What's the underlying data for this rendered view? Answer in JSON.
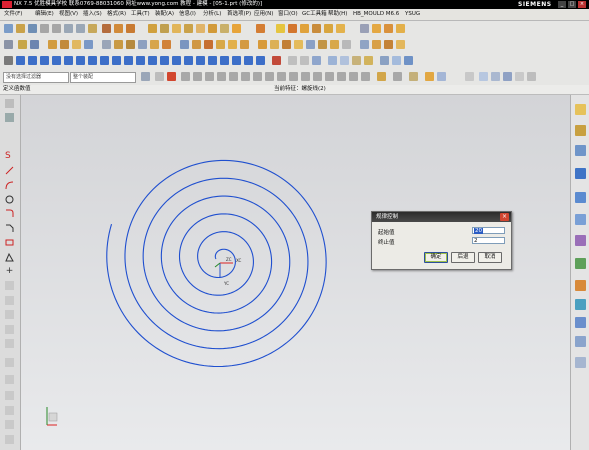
{
  "window": {
    "title": "NX 7.5 优胜模具学校 联系0769-88031060 网址www.yong.com 教程 - 建模 - [05-1.prt (修改的)]",
    "brand": "SIEMENS",
    "controls": [
      "_",
      "□",
      "×"
    ]
  },
  "menu": {
    "items": [
      "文件(F)",
      "编辑(E)",
      "视图(V)",
      "插入(S)",
      "格式(R)",
      "工具(T)",
      "装配(A)",
      "信息(I)",
      "分析(L)",
      "首选项(P)",
      "应用(N)",
      "窗口(O)",
      "GC工具箱",
      "帮助(H)",
      "HB_MOULD M6.6",
      "YSUG"
    ]
  },
  "toolbar": {
    "filter_select": "没有选择过滤器",
    "scope_select": "整个装配"
  },
  "status": {
    "left": "定义函数值",
    "center": "当前特征：螺旋线(2)"
  },
  "dialog": {
    "title": "规律控制",
    "start_label": "起始值",
    "start_value": "20",
    "end_label": "终止值",
    "end_value": "2",
    "ok_label": "确定",
    "back_label": "后退",
    "cancel_label": "取消"
  },
  "canvas": {
    "csys_x_label": "XC",
    "csys_y_label": "YC",
    "csys_z_label": "ZC"
  },
  "colors": {
    "spiral": "#1f4fcf",
    "dialog_title": "#2b2b2b",
    "close": "#d1452f"
  },
  "icons": {
    "left_toolbar": [
      "select-icon",
      "spline-icon",
      "line-icon",
      "arc-icon",
      "circle-icon",
      "fillet-icon",
      "rectangle-icon",
      "polygon-icon",
      "point-icon",
      "trim-icon"
    ],
    "right_toolbar": [
      "assembly-navigator-icon",
      "part-navigator-icon",
      "history-icon",
      "browser-icon",
      "roles-icon",
      "system-materials-icon",
      "palette-icon"
    ]
  }
}
